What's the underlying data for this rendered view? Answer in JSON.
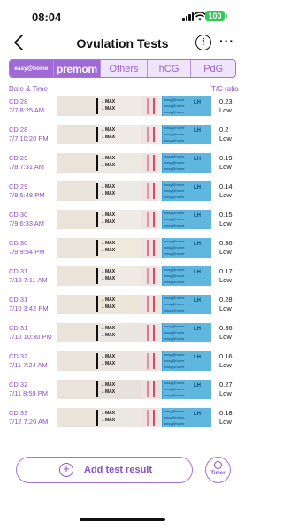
{
  "status_bar": {
    "time": "08:04",
    "battery": "100"
  },
  "header": {
    "title": "Ovulation Tests"
  },
  "tabs": [
    {
      "label": "easy@home",
      "active": true
    },
    {
      "label": "premom",
      "active": true
    },
    {
      "label": "Others",
      "active": false
    },
    {
      "label": "hCG",
      "active": false
    },
    {
      "label": "PdG",
      "active": false
    }
  ],
  "list": {
    "col_date": "Date & Time",
    "col_ratio": "T/C ratio",
    "rows": [
      {
        "cd": "CD 28",
        "date": "7/7 8:25 AM",
        "ratio": "0.23",
        "level": "Low"
      },
      {
        "cd": "CD 28",
        "date": "7/7 10:20 PM",
        "ratio": "0.2",
        "level": "Low"
      },
      {
        "cd": "CD 29",
        "date": "7/8 7:31 AM",
        "ratio": "0.19",
        "level": "Low"
      },
      {
        "cd": "CD 29",
        "date": "7/8 5:48 PM",
        "ratio": "0.14",
        "level": "Low"
      },
      {
        "cd": "CD 30",
        "date": "7/9 6:33 AM",
        "ratio": "0.15",
        "level": "Low"
      },
      {
        "cd": "CD 30",
        "date": "7/9 9:54 PM",
        "ratio": "0.36",
        "level": "Low"
      },
      {
        "cd": "CD 31",
        "date": "7/10 7:11 AM",
        "ratio": "0.17",
        "level": "Low"
      },
      {
        "cd": "CD 31",
        "date": "7/10 3:42 PM",
        "ratio": "0.28",
        "level": "Low"
      },
      {
        "cd": "CD 31",
        "date": "7/10 10:30 PM",
        "ratio": "0.36",
        "level": "Low"
      },
      {
        "cd": "CD 32",
        "date": "7/11 7:24 AM",
        "ratio": "0.16",
        "level": "Low"
      },
      {
        "cd": "CD 32",
        "date": "7/11 8:59 PM",
        "ratio": "0.27",
        "level": "Low"
      },
      {
        "cd": "CD 33",
        "date": "7/12 7:20 AM",
        "ratio": "0.18",
        "level": "Low"
      }
    ]
  },
  "strip": {
    "max_label": "MAX",
    "brand": "easy@home",
    "lh_label": "LH"
  },
  "actions": {
    "add_label": "Add test result",
    "timer_label": "Timer"
  },
  "colors": {
    "accent": "#a06ad6",
    "text_purple": "#8a4fc7",
    "strip_blue": "#5fb6df",
    "test_line": "#d44a68"
  }
}
